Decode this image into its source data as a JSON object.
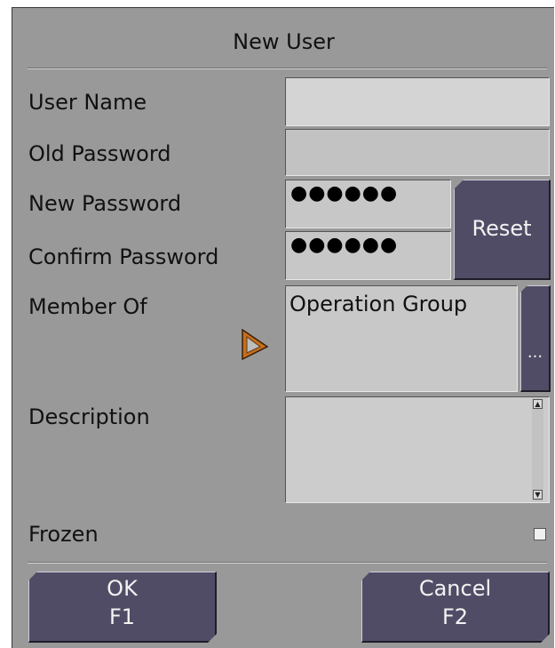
{
  "dialog": {
    "title": "New User",
    "fields": {
      "user_name": {
        "label": "User Name",
        "value": ""
      },
      "old_password": {
        "label": "Old Password",
        "value": ""
      },
      "new_password": {
        "label": "New Password",
        "value": "●●●●●●"
      },
      "confirm_password": {
        "label": "Confirm Password",
        "value": "●●●●●●"
      },
      "member_of": {
        "label": "Member Of",
        "value": "Operation Group",
        "browse_label": "..."
      },
      "description": {
        "label": "Description",
        "value": ""
      },
      "frozen": {
        "label": "Frozen",
        "checked": false
      }
    },
    "reset_label": "Reset",
    "ok": {
      "label": "OK",
      "key": "F1"
    },
    "cancel": {
      "label": "Cancel",
      "key": "F2"
    }
  },
  "colors": {
    "dialog_bg": "#999999",
    "button_bg": "#514c66",
    "field_bg": "#d2d2d2"
  },
  "icons": {
    "cursor": "pointer-arrow-icon",
    "scroll_up": "scroll-up-arrow-icon",
    "scroll_down": "scroll-down-arrow-icon"
  }
}
